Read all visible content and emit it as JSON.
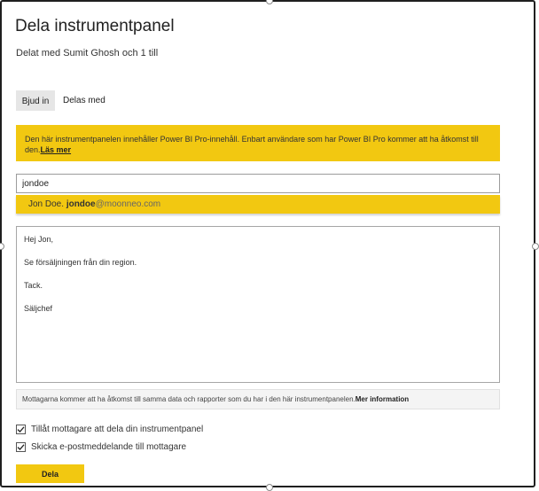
{
  "dialog": {
    "title": "Dela instrumentpanel",
    "subtitle": "Delat med Sumit Ghosh och 1 till"
  },
  "tabs": [
    {
      "label": "Bjud in",
      "selected": true
    },
    {
      "label": "Delas med",
      "selected": false
    }
  ],
  "banner": {
    "text": "Den här instrumentpanelen innehåller Power BI Pro-innehåll. Enbart användare som har Power BI Pro kommer att ha åtkomst till den.",
    "link": "Läs mer",
    "color": "#f2c811"
  },
  "search": {
    "value": "jondoe"
  },
  "suggestion": {
    "name": "Jon Doe.",
    "email_match": "jondoe",
    "email_rest": "@moonneo.com"
  },
  "message": {
    "lines": [
      "Hej Jon,",
      "Se försäljningen från din region.",
      "Tack.",
      "Säljchef"
    ]
  },
  "info": {
    "text": "Mottagarna kommer att ha åtkomst till samma data och rapporter som du har i den här instrumentpanelen.",
    "link": "Mer information"
  },
  "options": [
    {
      "label": "Tillåt mottagare att dela din instrumentpanel",
      "checked": true
    },
    {
      "label": "Skicka e-postmeddelande till mottagare",
      "checked": true
    }
  ],
  "share_button": {
    "label": "Dela"
  }
}
